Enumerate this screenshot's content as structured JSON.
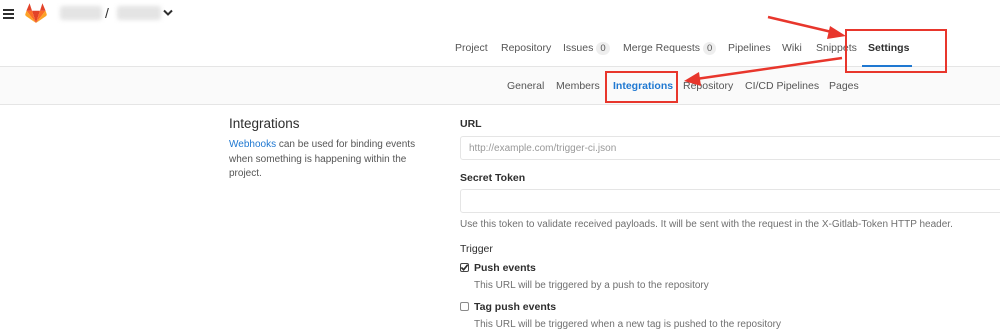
{
  "header": {
    "project_path_separator": "/"
  },
  "project_nav": {
    "items": [
      {
        "label": "Project"
      },
      {
        "label": "Repository"
      },
      {
        "label": "Issues",
        "badge": "0"
      },
      {
        "label": "Merge Requests",
        "badge": "0"
      },
      {
        "label": "Pipelines"
      },
      {
        "label": "Wiki"
      },
      {
        "label": "Snippets"
      },
      {
        "label": "Settings",
        "active": true
      }
    ]
  },
  "settings_nav": {
    "items": [
      {
        "label": "General"
      },
      {
        "label": "Members"
      },
      {
        "label": "Integrations",
        "active": true
      },
      {
        "label": "Repository"
      },
      {
        "label": "CI/CD Pipelines"
      },
      {
        "label": "Pages"
      }
    ]
  },
  "section": {
    "title": "Integrations",
    "desc_link": "Webhooks",
    "desc_rest": " can be used for binding events when something is happening within the project."
  },
  "form": {
    "url_label": "URL",
    "url_placeholder": "http://example.com/trigger-ci.json",
    "url_value": "",
    "token_label": "Secret Token",
    "token_value": "",
    "token_help": "Use this token to validate received payloads. It will be sent with the request in the X-Gitlab-Token HTTP header.",
    "trigger_label": "Trigger",
    "triggers": [
      {
        "label": "Push events",
        "checked": true,
        "help": "This URL will be triggered by a push to the repository"
      },
      {
        "label": "Tag push events",
        "checked": false,
        "help": "This URL will be triggered when a new tag is pushed to the repository"
      }
    ]
  },
  "icons": {
    "menu": "hamburger-icon",
    "logo": "gitlab-logo-icon",
    "dropdown": "chevron-down-icon",
    "check": "check-icon"
  },
  "colors": {
    "accent": "#1f78d1",
    "annotation_red": "#e8362c",
    "gitlab_orange": "#fc6d26"
  }
}
